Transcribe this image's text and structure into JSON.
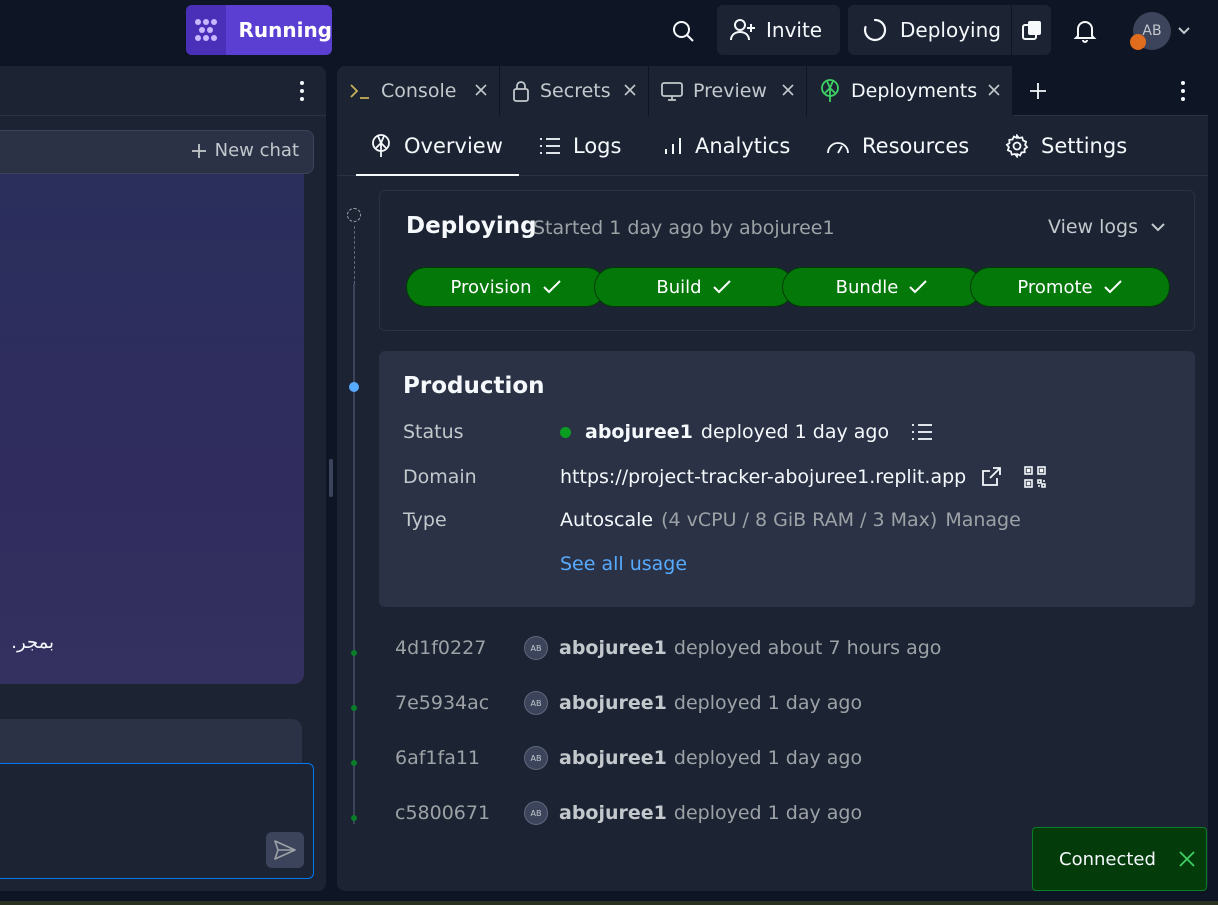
{
  "topbar": {
    "run_label": "Running",
    "invite_label": "Invite",
    "deploy_label": "Deploying",
    "avatar_initials": "AB"
  },
  "left": {
    "new_chat_label": "New chat",
    "chat_snippet": "بمجر."
  },
  "tabs": [
    {
      "label": "Console",
      "icon": "terminal-icon"
    },
    {
      "label": "Secrets",
      "icon": "lock-icon"
    },
    {
      "label": "Preview",
      "icon": "monitor-icon"
    },
    {
      "label": "Deployments",
      "icon": "deployments-icon"
    }
  ],
  "subnav": [
    {
      "label": "Overview",
      "icon": "deployments-icon",
      "active": true
    },
    {
      "label": "Logs",
      "icon": "list-icon"
    },
    {
      "label": "Analytics",
      "icon": "bar-chart-icon"
    },
    {
      "label": "Resources",
      "icon": "gauge-icon"
    },
    {
      "label": "Settings",
      "icon": "gear-icon"
    }
  ],
  "deploying": {
    "title": "Deploying",
    "subtitle": "Started 1 day ago by abojuree1",
    "view_logs": "View logs",
    "steps": [
      "Provision",
      "Build",
      "Bundle",
      "Promote"
    ]
  },
  "production": {
    "title": "Production",
    "status_label": "Status",
    "status_user": "abojuree1",
    "status_text": "deployed 1 day ago",
    "domain_label": "Domain",
    "domain_value": "https://project-tracker-abojuree1.replit.app",
    "type_label": "Type",
    "type_value": "Autoscale",
    "type_detail": "(4 vCPU / 8 GiB RAM / 3 Max)",
    "manage_label": "Manage",
    "usage_link": "See all usage"
  },
  "history": [
    {
      "sha": "4d1f0227",
      "avatar": "AB",
      "user": "abojuree1",
      "text": "deployed about 7 hours ago"
    },
    {
      "sha": "7e5934ac",
      "avatar": "AB",
      "user": "abojuree1",
      "text": "deployed 1 day ago"
    },
    {
      "sha": "6af1fa11",
      "avatar": "AB",
      "user": "abojuree1",
      "text": "deployed 1 day ago"
    },
    {
      "sha": "c5800671",
      "avatar": "AB",
      "user": "abojuree1",
      "text": "deployed 1 day ago"
    }
  ],
  "toast": {
    "label": "Connected"
  },
  "colors": {
    "background": "#0e1525",
    "panel": "#1c2333",
    "accent_run": "#5b3fd2",
    "step_green": "#04790a",
    "link_blue": "#57abff",
    "status_green": "#0a9d22"
  }
}
